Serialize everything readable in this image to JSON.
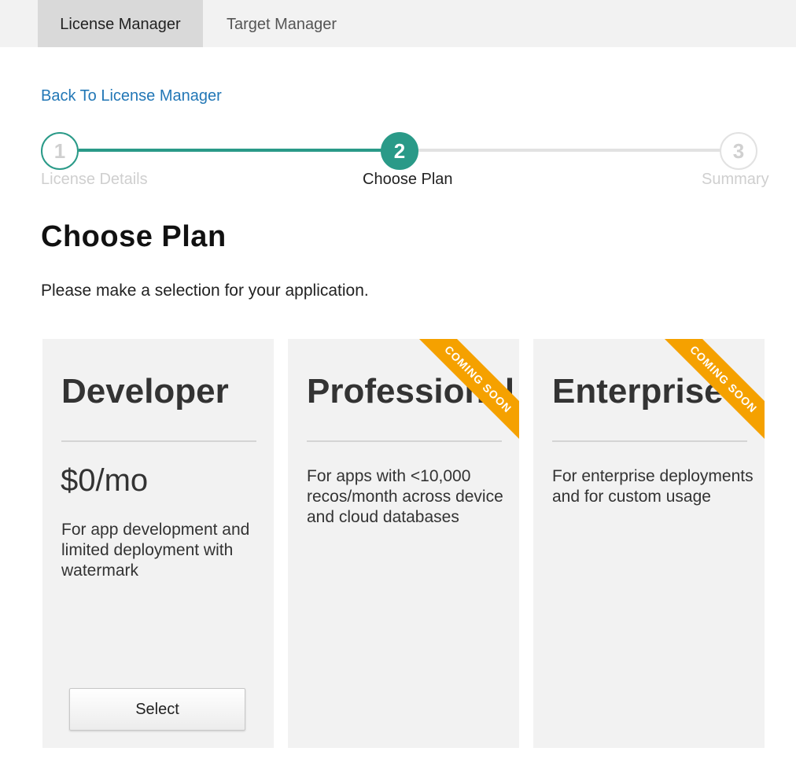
{
  "tabs": {
    "license_manager": "License Manager",
    "target_manager": "Target Manager"
  },
  "back_link": "Back To License Manager",
  "stepper": {
    "steps": [
      {
        "number": "1",
        "label": "License Details",
        "state": "completed"
      },
      {
        "number": "2",
        "label": "Choose Plan",
        "state": "current"
      },
      {
        "number": "3",
        "label": "Summary",
        "state": "upcoming"
      }
    ]
  },
  "page": {
    "title": "Choose Plan",
    "subtitle": "Please make a selection for your application."
  },
  "plans": [
    {
      "name": "Developer",
      "price": "$0/mo",
      "description": "For app development and limited deployment with watermark",
      "button_label": "Select"
    },
    {
      "name": "Professional",
      "description": "For apps with <10,000 recos/month across device and cloud databases",
      "ribbon": "COMING SOON"
    },
    {
      "name": "Enterprise",
      "description": "For enterprise deployments and for custom usage",
      "ribbon": "COMING SOON"
    }
  ],
  "colors": {
    "accent_teal": "#2a9a88",
    "link_blue": "#2277b6",
    "ribbon_orange": "#f5a100",
    "card_bg": "#f2f2f2",
    "tabbar_bg": "#f2f2f2",
    "active_tab_bg": "#d9d9d9"
  }
}
